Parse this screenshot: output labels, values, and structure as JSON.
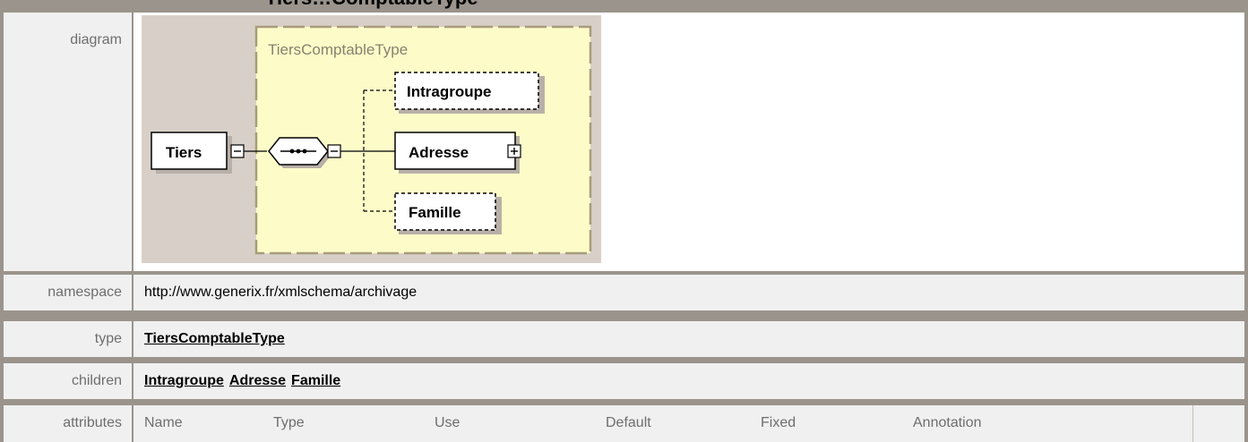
{
  "title": "Tiers…ComptableType",
  "rows": {
    "diagram_label": "diagram",
    "namespace_label": "namespace",
    "namespace_value": "http://www.generix.fr/xmlschema/archivage",
    "type_label": "type",
    "type_value": "TiersComptableType",
    "children_label": "children",
    "children": [
      "Intragroupe",
      "Adresse",
      "Famille"
    ],
    "attributes_label": "attributes",
    "attribute_headers": [
      "Name",
      "Type",
      "Use",
      "Default",
      "Fixed",
      "Annotation"
    ]
  },
  "diagram": {
    "complex_type_name": "TiersComptableType",
    "root_element": "Tiers",
    "elements": [
      "Intragroupe",
      "Adresse",
      "Famille"
    ],
    "optional": [
      "Intragroupe",
      "Famille"
    ],
    "expandable": [
      "Adresse"
    ]
  },
  "colors": {
    "type_box_fill": "#fdfcc8",
    "type_box_border": "#a89c7c",
    "diagram_bg": "#d8d0c8",
    "label_text": "#6e6e6e",
    "cell_bg": "#f0f0f0"
  }
}
